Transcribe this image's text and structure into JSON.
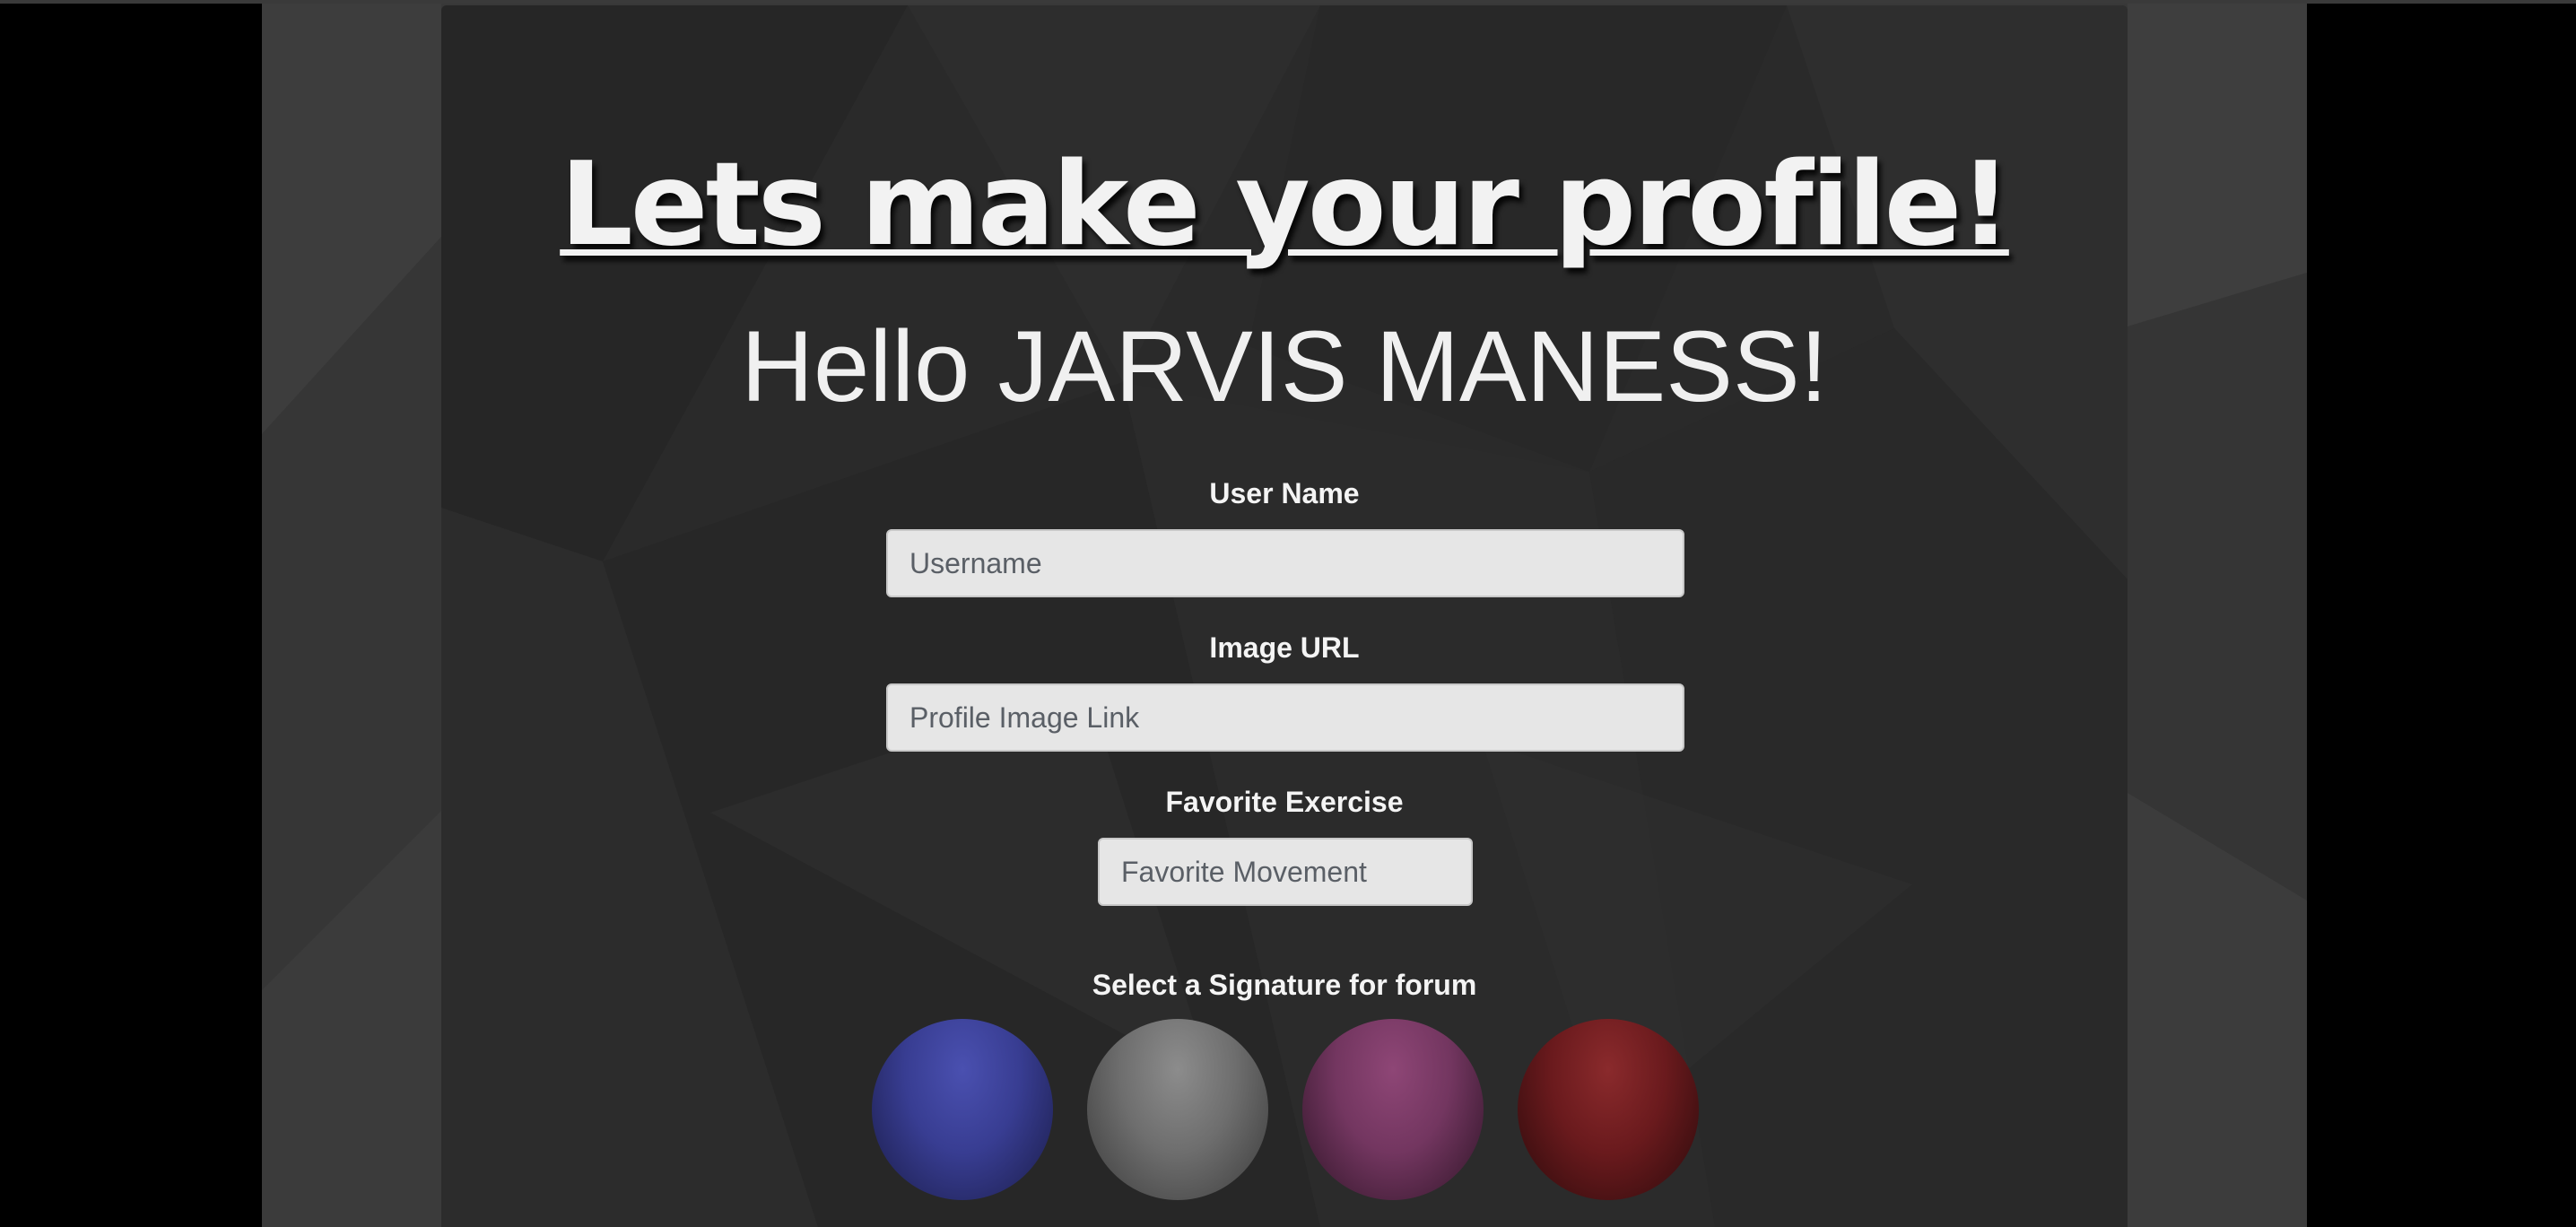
{
  "page": {
    "title": "Lets make your profile!",
    "greeting": "Hello JARVIS MANESS!"
  },
  "form": {
    "username": {
      "label": "User Name",
      "placeholder": "Username",
      "value": ""
    },
    "image_url": {
      "label": "Image URL",
      "placeholder": "Profile Image Link",
      "value": ""
    },
    "favorite_exercise": {
      "label": "Favorite Exercise",
      "placeholder": "Favorite Movement",
      "value": ""
    },
    "signature": {
      "label": "Select a Signature for forum",
      "options": [
        {
          "name": "blue",
          "color": "#3b3f9a"
        },
        {
          "name": "gray",
          "color": "#7a7a7a"
        },
        {
          "name": "magenta",
          "color": "#7e3a66"
        },
        {
          "name": "red",
          "color": "#7a1f22"
        }
      ]
    }
  },
  "colors": {
    "page_background": "#000000",
    "outer_panel": "#383838",
    "inner_panel": "#2a2a2a",
    "text": "#f2f2f2",
    "input_background": "#e6e6e6"
  }
}
